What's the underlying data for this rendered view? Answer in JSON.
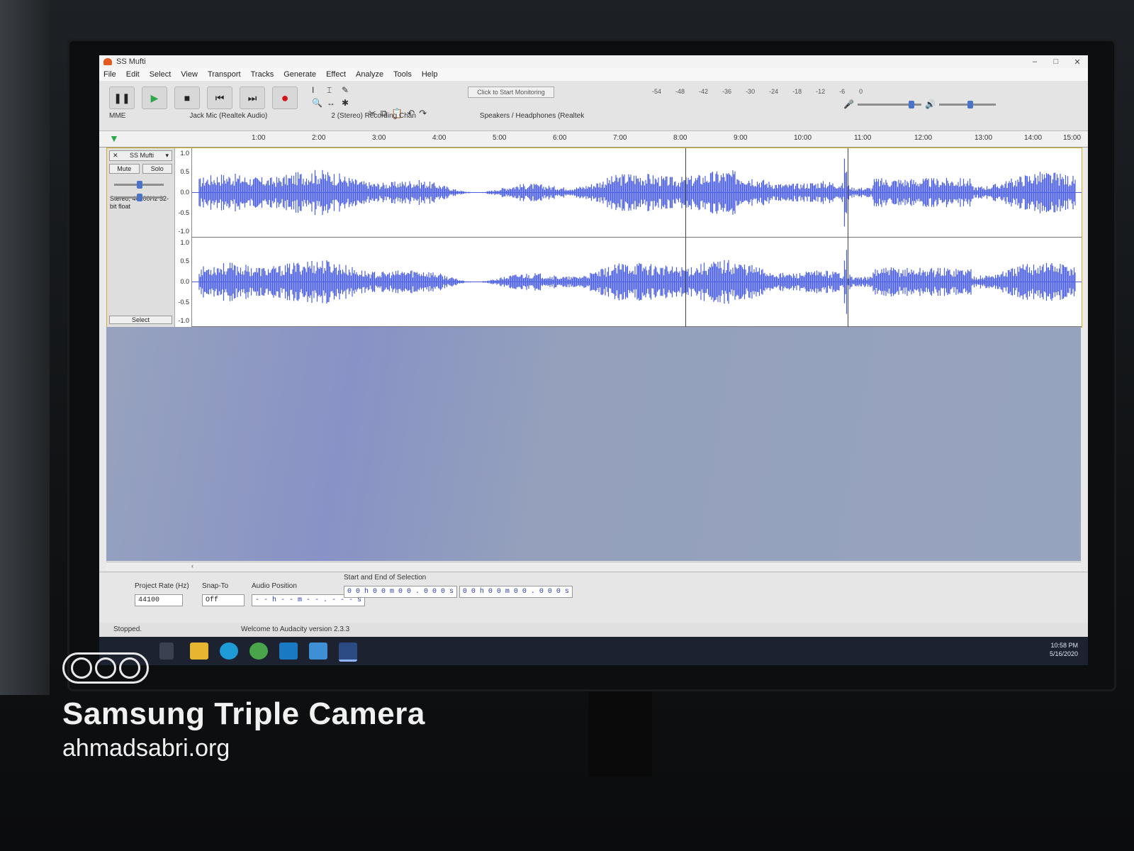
{
  "window": {
    "title": "SS Mufti",
    "controls": [
      "–",
      "□",
      "✕"
    ]
  },
  "menu": [
    "File",
    "Edit",
    "Select",
    "View",
    "Transport",
    "Tracks",
    "Generate",
    "Effect",
    "Analyze",
    "Tools",
    "Help"
  ],
  "toolbar": {
    "transport": [
      {
        "name": "pause-button",
        "glyph": "❚❚"
      },
      {
        "name": "play-button",
        "glyph": "▶"
      },
      {
        "name": "stop-button",
        "glyph": "■"
      },
      {
        "name": "skip-start-button",
        "glyph": "⏮"
      },
      {
        "name": "skip-end-button",
        "glyph": "⏭"
      },
      {
        "name": "record-button",
        "glyph": "●"
      }
    ],
    "tools": [
      "I",
      "⌶",
      "✎",
      "🔍",
      "↔",
      "✱"
    ],
    "edit_tools": [
      "✂",
      "⧉",
      "📋",
      "↶",
      "↷"
    ],
    "meter_prompt": "Click to Start Monitoring",
    "meter_scale": [
      "-54",
      "-48",
      "-42",
      "-36",
      "-30",
      "-24",
      "-18",
      "-12",
      "-6",
      "0"
    ],
    "host": "MME",
    "recording_device": "Jack Mic (Realtek Audio)",
    "channels": "2 (Stereo) Recording Chan",
    "playback_device": "Speakers / Headphones (Realtek"
  },
  "ruler": {
    "ticks": [
      "1:00",
      "2:00",
      "3:00",
      "4:00",
      "5:00",
      "6:00",
      "7:00",
      "8:00",
      "9:00",
      "10:00",
      "11:00",
      "12:00",
      "13:00",
      "14:00",
      "15:00"
    ]
  },
  "track": {
    "name": "SS Mufti",
    "mute": "Mute",
    "solo": "Solo",
    "format": "Stereo, 44100Hz 32-bit float",
    "select": "Select",
    "scale": [
      "1.0",
      "0.5",
      "0.0",
      "-0.5",
      "-1.0"
    ],
    "wave_color": "#4a5ee0"
  },
  "selection_bar": {
    "project_rate_label": "Project Rate (Hz)",
    "project_rate": "44100",
    "snap_label": "Snap-To",
    "snap_value": "Off",
    "audio_position_label": "Audio Position",
    "audio_position": "- - h - - m - - . - - - s",
    "selection_label": "Start and End of Selection",
    "selection_start": "0 0 h 0 0 m 0 0 . 0 0 0 s",
    "selection_end": "0 0 h 0 0 m 0 0 . 0 0 0 s"
  },
  "status": {
    "state": "Stopped.",
    "message": "Welcome to Audacity version 2.3.3"
  },
  "clock": {
    "time": "10:58 PM",
    "date": "5/16/2020"
  },
  "watermark": {
    "title": "Samsung Triple Camera",
    "url": "ahmadsabri.org"
  }
}
